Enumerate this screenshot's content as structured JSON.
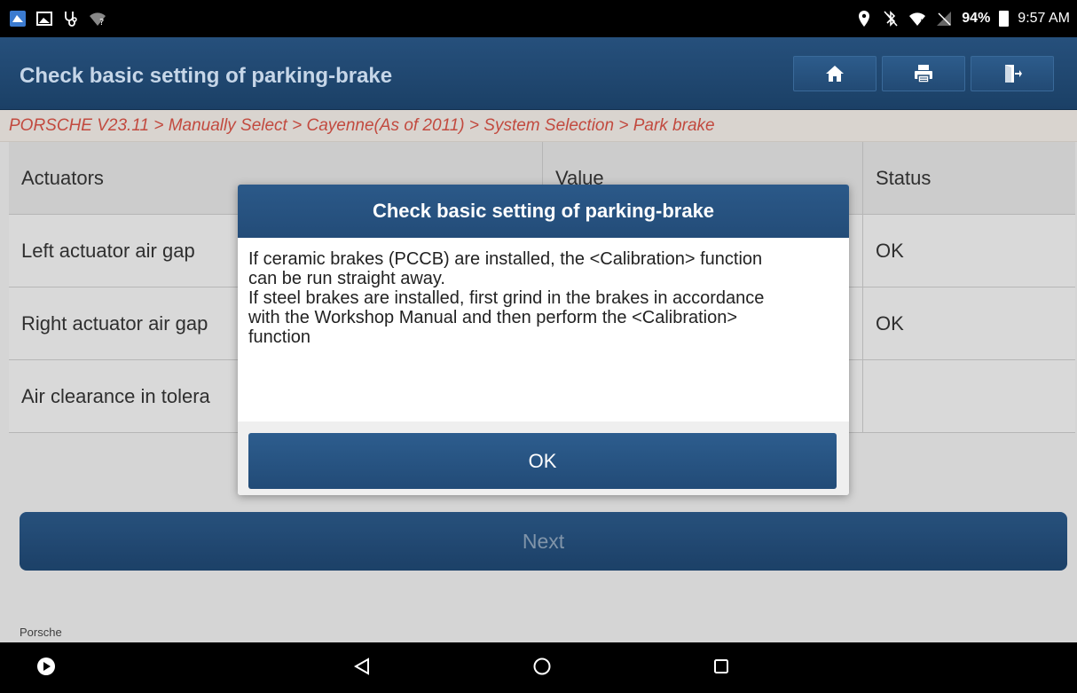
{
  "status_bar": {
    "left_icons": [
      "launcher-app-icon",
      "image-icon",
      "stethoscope-icon",
      "wifi-unknown-icon"
    ],
    "right_icons": [
      "location-icon",
      "bluetooth-off-icon",
      "wifi-icon",
      "no-sim-icon",
      "battery-icon"
    ],
    "battery_percent": "94%",
    "time": "9:57 AM"
  },
  "header": {
    "title": "Check basic setting of parking-brake",
    "buttons": [
      "home-icon",
      "print-icon",
      "exit-icon"
    ]
  },
  "breadcrumb": {
    "text": "PORSCHE V23.11 > Manually Select > Cayenne(As of 2011) > System Selection > Park brake"
  },
  "table": {
    "columns": [
      "Actuators",
      "Value",
      "Status"
    ],
    "rows": [
      {
        "actuator": "Left actuator air gap",
        "value": "",
        "status": "OK"
      },
      {
        "actuator": "Right actuator air gap",
        "value": "",
        "status": "OK"
      },
      {
        "actuator": "Air clearance in tolera",
        "value": "",
        "status": ""
      }
    ]
  },
  "next_button": {
    "label": "Next"
  },
  "footer": {
    "brand": "Porsche"
  },
  "dialog": {
    "title": "Check basic setting of parking-brake",
    "lines": [
      "If ceramic brakes (PCCB) are installed, the <Calibration> function",
      "can be run straight away.",
      "If steel brakes are installed, first grind in the brakes in accordance",
      "with the Workshop Manual and then perform the <Calibration>",
      "function"
    ],
    "ok_label": "OK"
  },
  "colors": {
    "header_blue": "#1f456e",
    "breadcrumb_red": "#c24a3f",
    "button_blue": "#2a5786"
  }
}
